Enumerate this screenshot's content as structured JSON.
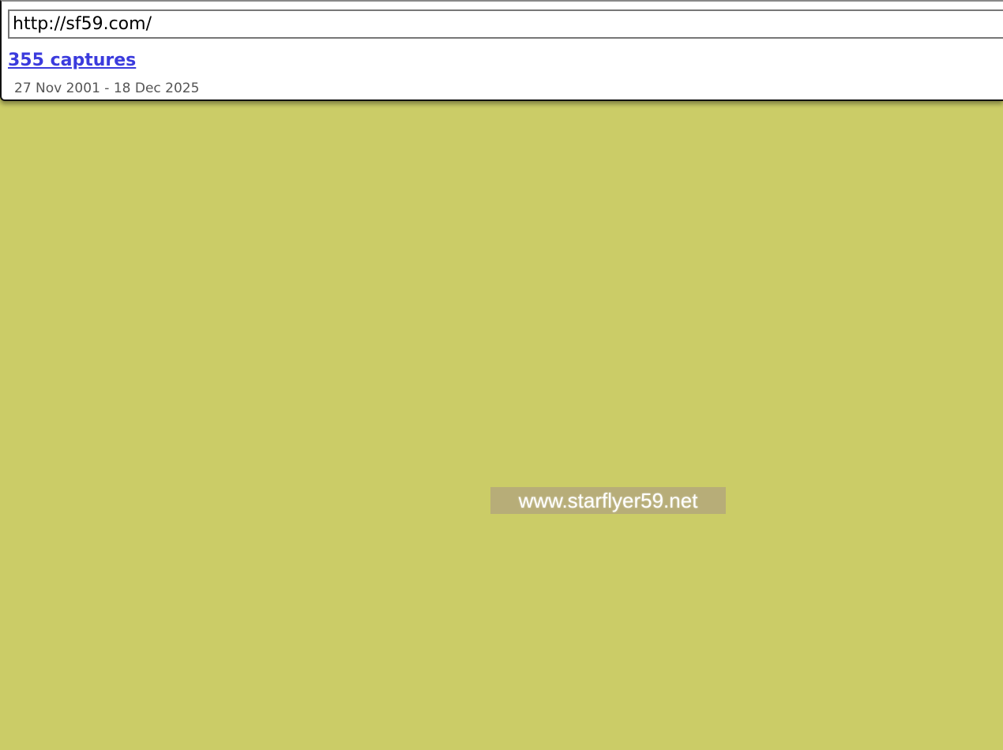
{
  "toolbar": {
    "url_value": "http://sf59.com/",
    "captures_label": "355 captures",
    "date_range": "27 Nov 2001 - 18 Dec 2025"
  },
  "page": {
    "background_color": "#cbcc67",
    "banner_text": "www.starflyer59.net"
  },
  "colors": {
    "link": "#3b3bdd",
    "banner_bg": "#b7ad78"
  }
}
